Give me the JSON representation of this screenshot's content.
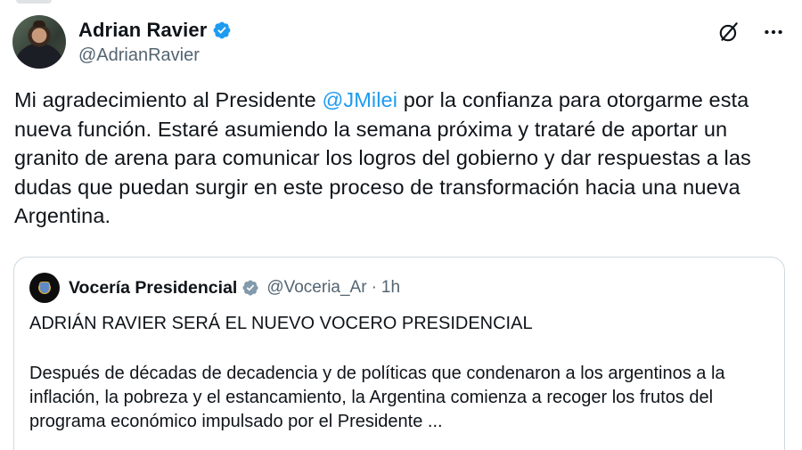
{
  "author": {
    "display_name": "Adrian Ravier",
    "handle": "@AdrianRavier",
    "verified": true
  },
  "header_icons": [
    "grok-icon",
    "more-icon"
  ],
  "tweet": {
    "text_before": "Mi agradecimiento al Presidente ",
    "mention": "@JMilei",
    "text_after": " por la confianza para otorgarme esta nueva función. Estaré asumiendo la semana próxima y trataré de aportar un granito de arena para comunicar los logros del gobierno y dar respuestas a las dudas que puedan surgir en este proceso de transformación hacia una nueva Argentina."
  },
  "quote": {
    "display_name": "Vocería Presidencial",
    "handle": "@Voceria_Ar",
    "separator": "·",
    "time": "1h",
    "headline": "ADRIÁN RAVIER SERÁ EL NUEVO VOCERO PRESIDENCIAL",
    "body": "Después de décadas de decadencia y de políticas que condenaron a los argentinos a la inflación, la pobreza y el estancamiento, la Argentina comienza a recoger los frutos del programa económico impulsado por el Presidente ..."
  },
  "colors": {
    "accent": "#1d9bf0",
    "text": "#0f1419",
    "secondary": "#536471",
    "border": "#cfd9de"
  }
}
